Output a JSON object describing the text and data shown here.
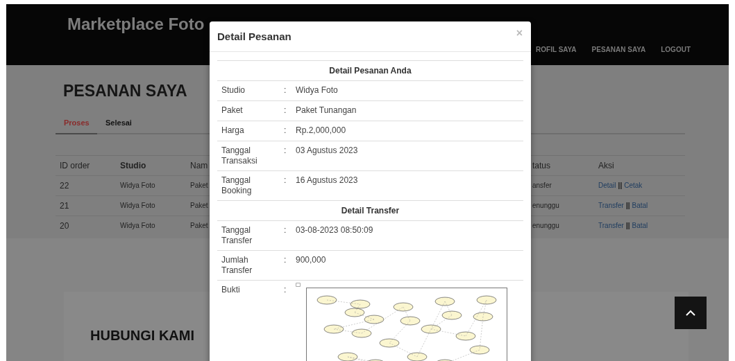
{
  "navbar": {
    "brand": "Marketplace Foto",
    "links": [
      {
        "label": "ROFIL SAYA"
      },
      {
        "label": "PESANAN SAYA"
      },
      {
        "label": "LOGOUT"
      }
    ]
  },
  "page": {
    "title": "PESANAN SAYA",
    "tabs": [
      {
        "label": "Proses",
        "selected": true
      },
      {
        "label": "Selesai",
        "selected": false
      }
    ]
  },
  "table": {
    "columns": [
      {
        "label": "ID order",
        "bold": false
      },
      {
        "label": "Studio",
        "bold": true
      },
      {
        "label": "Nam",
        "bold": false
      },
      {
        "label": "tatus",
        "bold": false
      },
      {
        "label": "Aksi",
        "bold": false
      }
    ],
    "rows": [
      {
        "id": "22",
        "studio": "Widya Foto",
        "column_3": "Paket",
        "status": "ansfer",
        "actions": [
          {
            "kind": "link",
            "label": "Detail"
          },
          {
            "kind": "separator",
            "label": "||"
          },
          {
            "kind": "link",
            "label": "Cetak"
          }
        ]
      },
      {
        "id": "21",
        "studio": "Widya Foto",
        "column_3": "Paket",
        "status": "enunggu",
        "actions": [
          {
            "kind": "link",
            "label": "Transfer"
          },
          {
            "kind": "separator",
            "label": "||"
          },
          {
            "kind": "link",
            "label": "Batal"
          }
        ]
      },
      {
        "id": "20",
        "studio": "Widya Foto",
        "column_3": "Paket",
        "status": "enunggu",
        "actions": [
          {
            "kind": "link",
            "label": "Transfer"
          },
          {
            "kind": "separator",
            "label": "||"
          },
          {
            "kind": "link",
            "label": "Batal"
          }
        ]
      }
    ]
  },
  "contact": {
    "title": "HUBUNGI KAMI"
  },
  "modal": {
    "title": "Detail Pesanan",
    "close": "×",
    "sections": [
      {
        "heading": "Detail Pesanan Anda",
        "rows": [
          {
            "kind": "text",
            "label": "Studio",
            "colon": ":",
            "value": "Widya Foto"
          },
          {
            "kind": "text",
            "label": "Paket",
            "colon": ":",
            "value": "Paket Tunangan"
          },
          {
            "kind": "text",
            "label": "Harga",
            "colon": ":",
            "value": "Rp.2,000,000"
          },
          {
            "kind": "text",
            "label": "Tanggal Transaksi",
            "colon": ":",
            "value": "03 Agustus 2023"
          },
          {
            "kind": "text",
            "label": "Tanggal Booking",
            "colon": ":",
            "value": "16 Agustus 2023"
          }
        ]
      },
      {
        "heading": "Detail Transfer",
        "rows": [
          {
            "kind": "text",
            "label": "Tanggal Transfer",
            "colon": ":",
            "value": "03-08-2023 08:50:09"
          },
          {
            "kind": "text",
            "label": "Jumlah Transfer",
            "colon": ":",
            "value": "900,000"
          },
          {
            "kind": "image",
            "label": "Bukti",
            "colon": ":"
          }
        ]
      }
    ]
  }
}
